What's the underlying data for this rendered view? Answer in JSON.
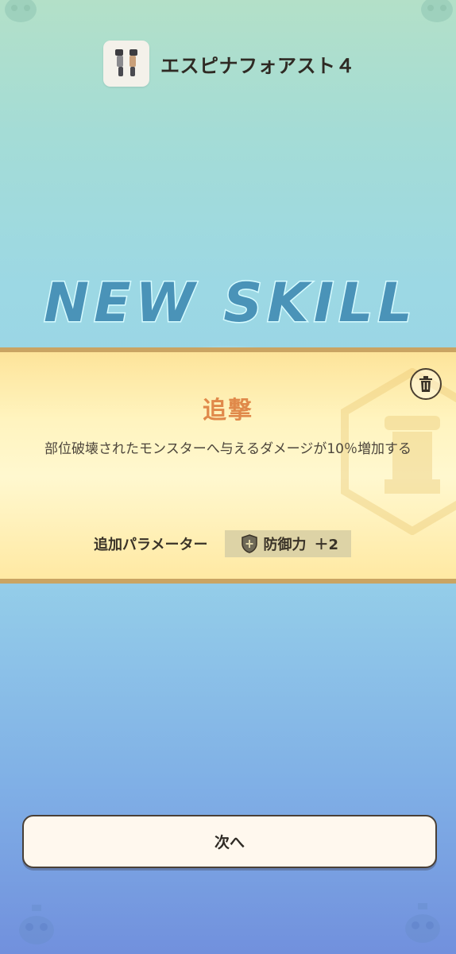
{
  "header": {
    "item_icon": "bracer-pair-icon",
    "item_name": "エスピナフォアスト４"
  },
  "banner": {
    "text": "NEW SKILL"
  },
  "skill": {
    "name": "追撃",
    "description": "部位破壊されたモンスターへ与えるダメージが10％増加する",
    "param_label": "追加パラメーター",
    "param_icon": "shield-icon",
    "param_name": "防御力",
    "param_value": "＋2",
    "delete_icon": "trash-icon"
  },
  "actions": {
    "next_label": "次へ"
  },
  "colors": {
    "title_accent": "#e0894a",
    "panel_border": "#c9a463",
    "chip_bg": "#ddd3a6"
  }
}
